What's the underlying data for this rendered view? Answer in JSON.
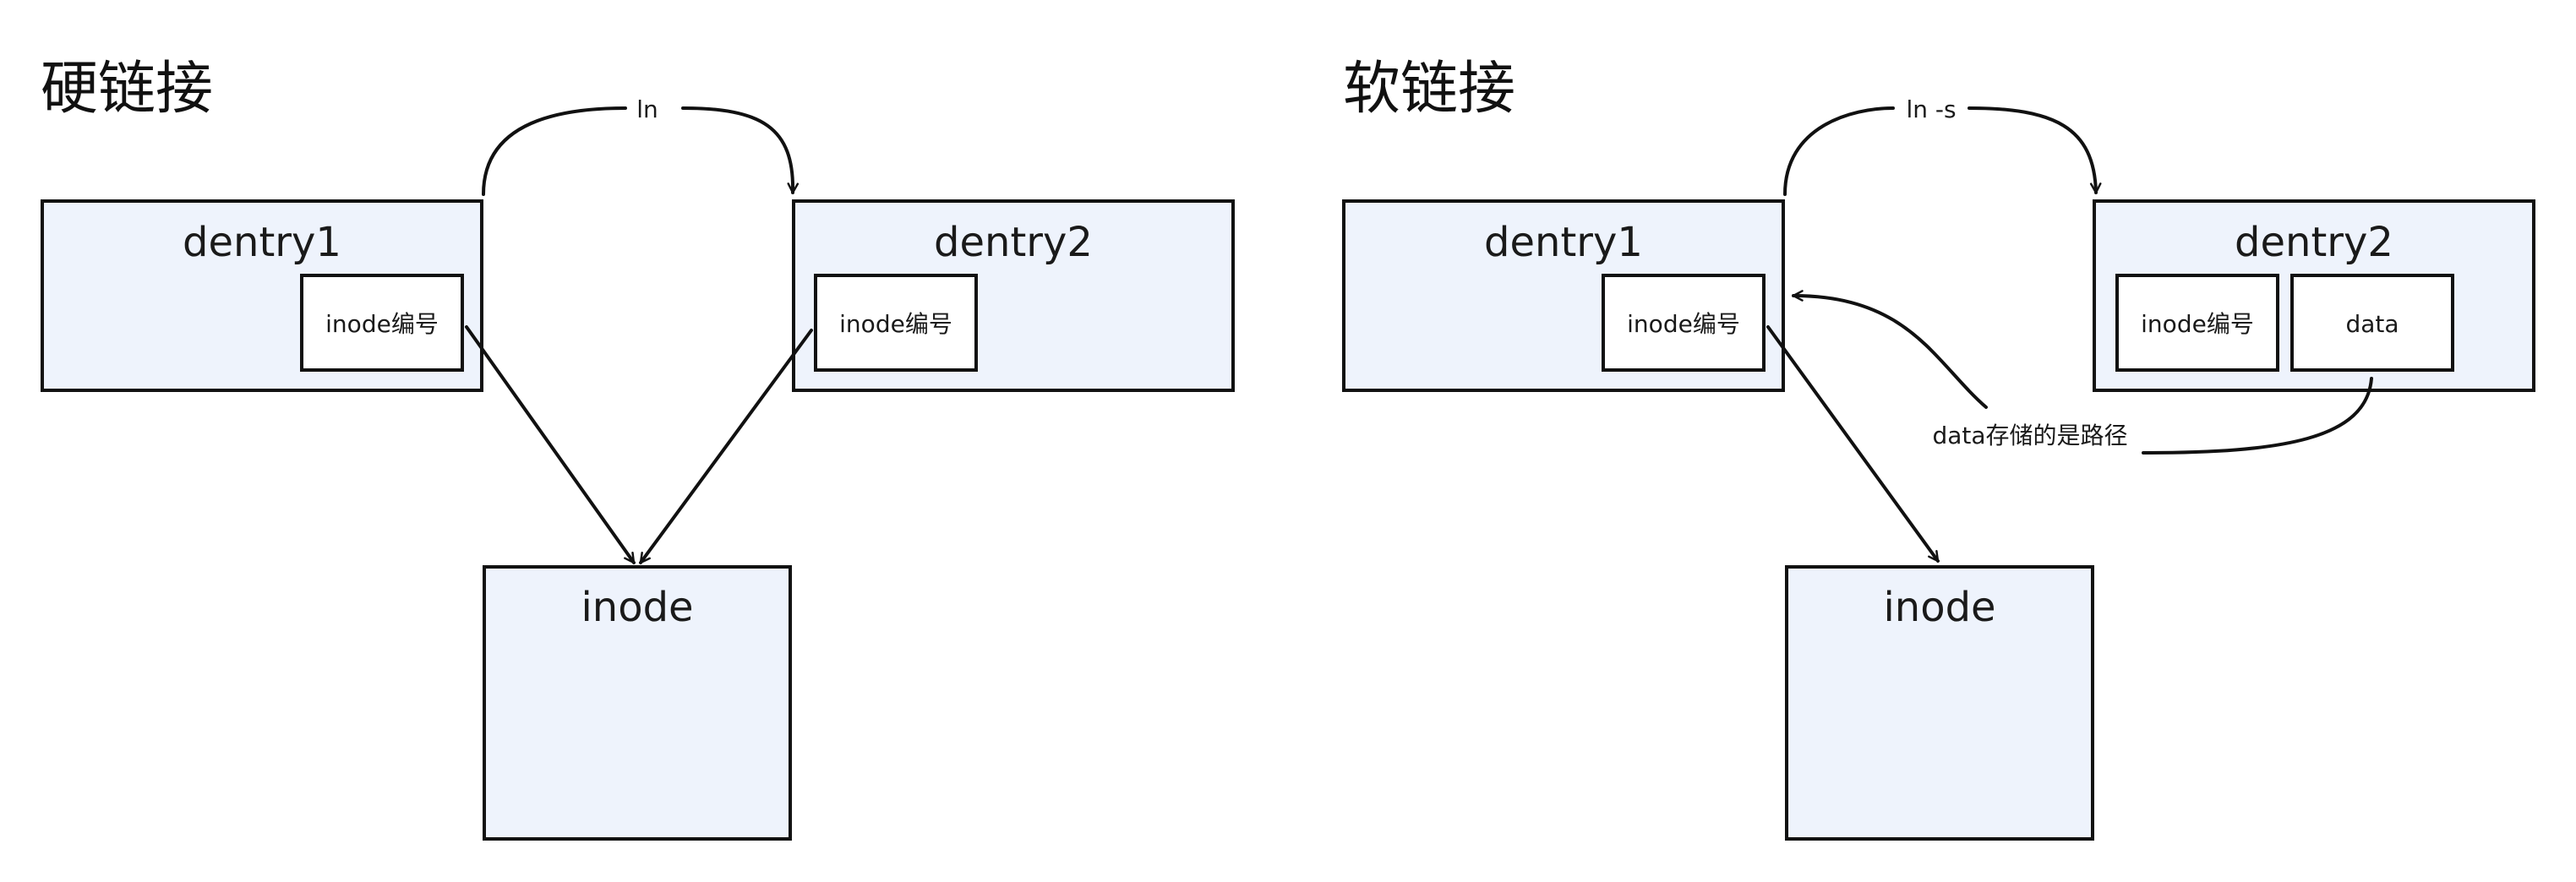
{
  "hard_link": {
    "title": "硬链接",
    "dentry1": {
      "label": "dentry1",
      "inode_field": "inode编号"
    },
    "dentry2": {
      "label": "dentry2",
      "inode_field": "inode编号"
    },
    "inode": {
      "label": "inode"
    },
    "command_label": "ln"
  },
  "soft_link": {
    "title": "软链接",
    "dentry1": {
      "label": "dentry1",
      "inode_field": "inode编号"
    },
    "dentry2": {
      "label": "dentry2",
      "inode_field": "inode编号",
      "data_field": "data"
    },
    "inode": {
      "label": "inode"
    },
    "command_label": "ln -s",
    "data_note": "data存储的是路径"
  },
  "colors": {
    "box_fill": "#eef3fc",
    "stroke": "#111111",
    "inner_fill": "#ffffff"
  }
}
